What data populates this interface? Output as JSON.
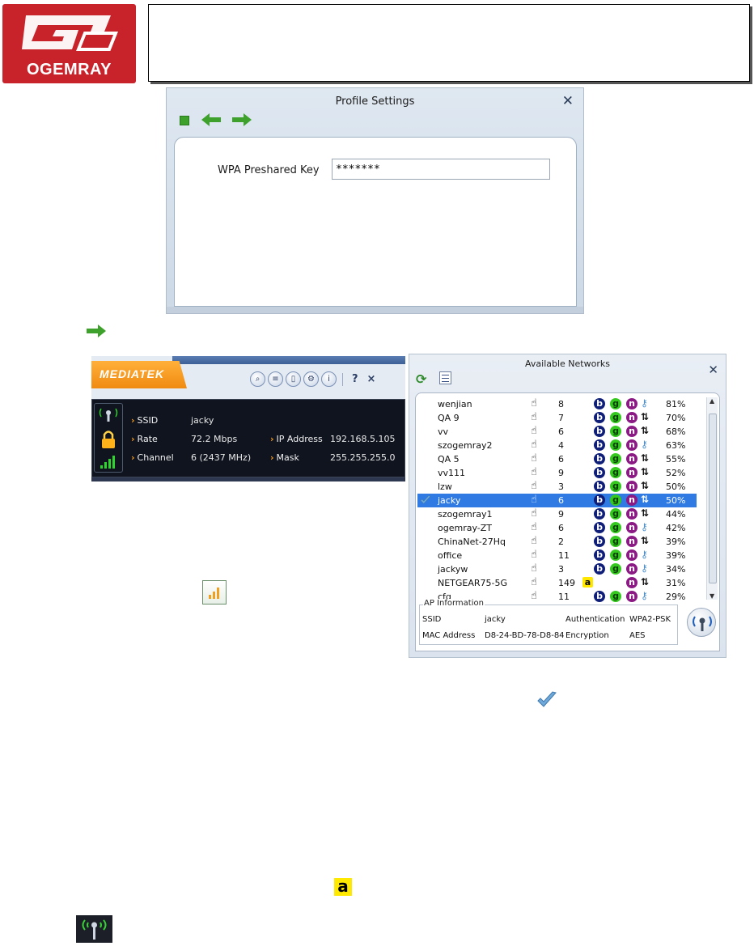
{
  "header": {
    "logo_text": "OGEMRAY",
    "logo_mark": "GEM"
  },
  "profile_dialog": {
    "title": "Profile Settings",
    "wpa_label": "WPA Preshared Key",
    "wpa_value": "*******"
  },
  "mediatek": {
    "brand": "MEDIATEK",
    "help_label": "?",
    "close_label": "×",
    "ssid_label": "SSID",
    "ssid_value": "jacky",
    "rate_label": "Rate",
    "rate_value": "72.2 Mbps",
    "channel_label": "Channel",
    "channel_value": "6 (2437 MHz)",
    "ip_label": "IP Address",
    "ip_value": "192.168.5.105",
    "mask_label": "Mask",
    "mask_value": "255.255.255.0"
  },
  "networks": {
    "title": "Available Networks",
    "rows": [
      {
        "ssid": "wenjian",
        "ch": "8",
        "modes": "bgn",
        "sec": "key",
        "signal": "81%"
      },
      {
        "ssid": "QA 9",
        "ch": "7",
        "modes": "bgn",
        "sec": "lock",
        "signal": "70%"
      },
      {
        "ssid": "vv",
        "ch": "6",
        "modes": "bgn",
        "sec": "lock",
        "signal": "68%"
      },
      {
        "ssid": "szogemray2",
        "ch": "4",
        "modes": "bgn",
        "sec": "key",
        "signal": "63%"
      },
      {
        "ssid": "QA 5",
        "ch": "6",
        "modes": "bgn",
        "sec": "lock",
        "signal": "55%"
      },
      {
        "ssid": "vv111",
        "ch": "9",
        "modes": "bgn",
        "sec": "lock",
        "signal": "52%"
      },
      {
        "ssid": "lzw",
        "ch": "3",
        "modes": "bgn",
        "sec": "lock",
        "signal": "50%"
      },
      {
        "ssid": "jacky",
        "ch": "6",
        "modes": "bgn",
        "sec": "lock",
        "signal": "50%",
        "selected": true
      },
      {
        "ssid": "szogemray1",
        "ch": "9",
        "modes": "bgn",
        "sec": "lock",
        "signal": "44%"
      },
      {
        "ssid": "ogemray-ZT",
        "ch": "6",
        "modes": "bgn",
        "sec": "key",
        "signal": "42%"
      },
      {
        "ssid": "ChinaNet-27Hq",
        "ch": "2",
        "modes": "bgn",
        "sec": "lock",
        "signal": "39%"
      },
      {
        "ssid": "office",
        "ch": "11",
        "modes": "bgn",
        "sec": "key",
        "signal": "39%"
      },
      {
        "ssid": "jackyw",
        "ch": "3",
        "modes": "bgn",
        "sec": "key",
        "signal": "34%"
      },
      {
        "ssid": "NETGEAR75-5G",
        "ch": "149",
        "modes": "an",
        "sec": "lock",
        "signal": "31%"
      },
      {
        "ssid": "cfq",
        "ch": "11",
        "modes": "bgn",
        "sec": "key",
        "signal": "29%"
      }
    ],
    "ap_info": {
      "legend": "AP Information",
      "ssid_label": "SSID",
      "ssid_value": "jacky",
      "auth_label": "Authentication",
      "auth_value": "WPA2-PSK",
      "mac_label": "MAC Address",
      "mac_value": "D8-24-BD-78-D8-84",
      "enc_label": "Encryption",
      "enc_value": "AES"
    }
  },
  "legend_icons": {
    "a_label": "a"
  },
  "colors": {
    "accent_orange": "#f08a10",
    "selection_blue": "#2f7be3",
    "logo_red": "#c8222a",
    "arrow_green": "#3ea12b"
  }
}
